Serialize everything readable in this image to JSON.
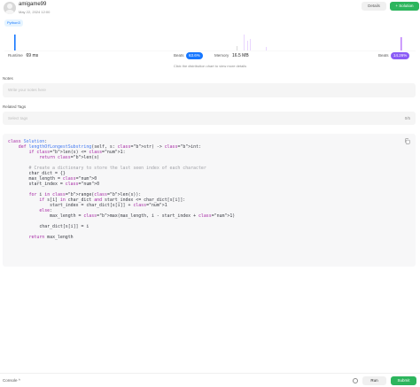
{
  "header": {
    "username": "amigame99",
    "date": "May 22, 2024 12:00",
    "details_label": "Details",
    "solution_label": "+ Solution"
  },
  "language": "Python3",
  "chart": {
    "color": "#1677ff",
    "dim_color": "#d9d9d9",
    "highlight_color": "#c084fc"
  },
  "stats": {
    "runtime_label": "Runtime",
    "runtime_value": "69 ms",
    "beats_label": "Beats",
    "runtime_beats": "63.6%",
    "memory_label": "Memory",
    "memory_value": "16.5 MB",
    "memory_beats": "14.26%"
  },
  "hint": "Click the distribution chart to view more details",
  "notes": {
    "label": "Notes",
    "placeholder": "Write your notes here"
  },
  "tags": {
    "label": "Related Tags",
    "placeholder": "Select tags",
    "count": "0/5"
  },
  "code_lines": [
    "class Solution:",
    "    def lengthOfLongestSubstring(self, s: str) -> int:",
    "        if len(s) <= 1:",
    "            return len(s)",
    "",
    "        # Create a dictionary to store the last seen index of each character",
    "        char_dict = {}",
    "        max_length = 0",
    "        start_index = 0",
    "",
    "        for i in range(len(s)):",
    "            if s[i] in char_dict and start_index <= char_dict[s[i]]:",
    "                start_index = char_dict[s[i]] + 1",
    "            else:",
    "                max_length = max(max_length, i - start_index + 1)",
    "",
    "            char_dict[s[i]] = i",
    "",
    "        return max_length"
  ],
  "footer": {
    "console_label": "Console ^",
    "run_label": "Run",
    "submit_label": "Submit"
  }
}
